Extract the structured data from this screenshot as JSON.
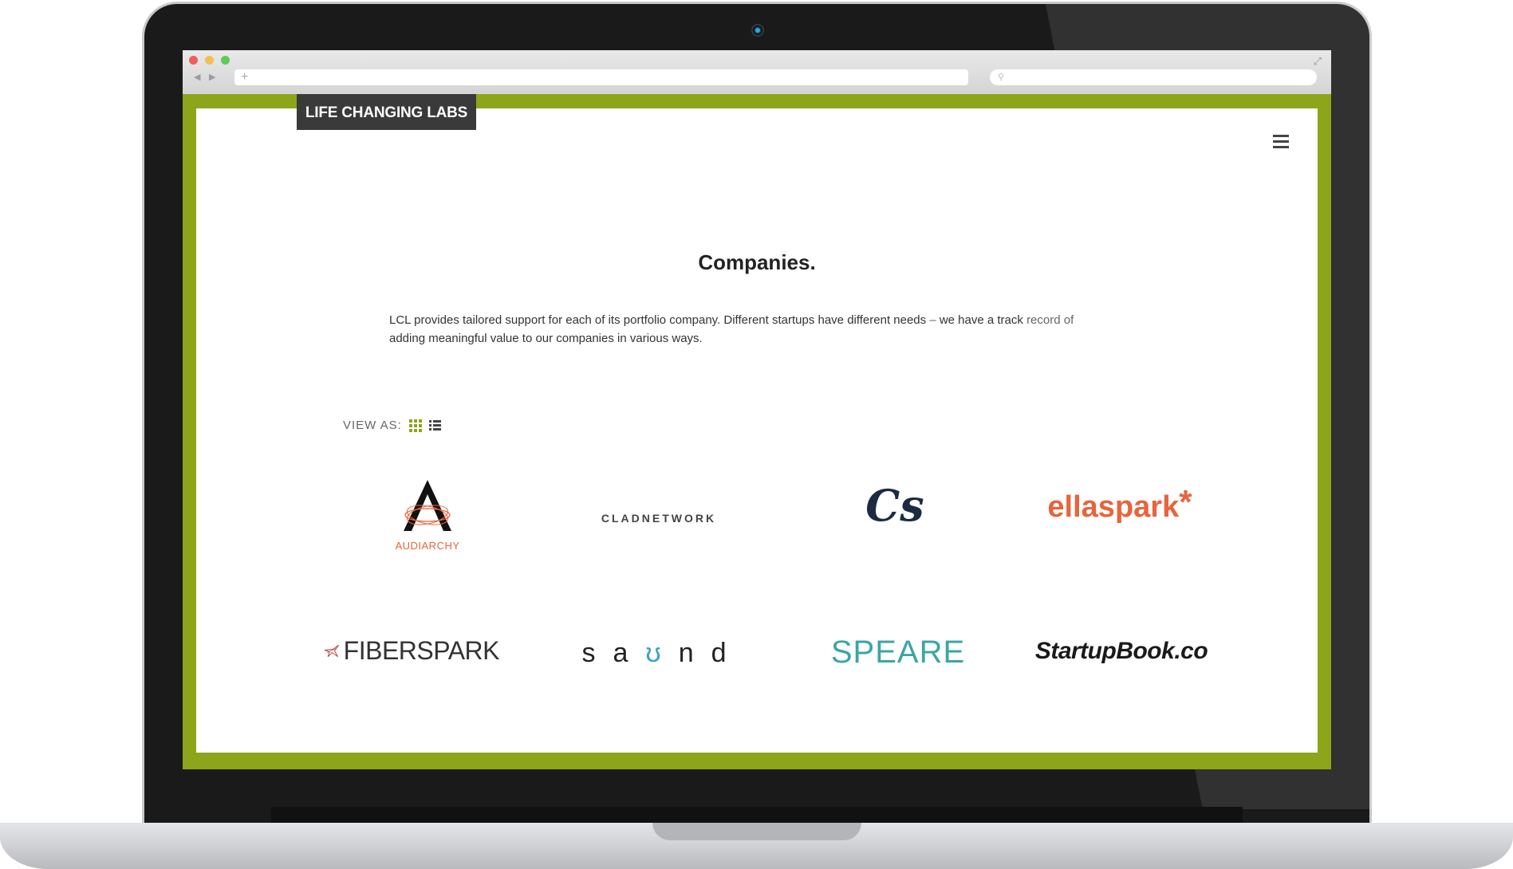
{
  "site": {
    "logo": "LIFE CHANGING LABS",
    "heading": "Companies.",
    "intro_main": "LCL provides tailored support for each of its portfolio company. Different startups have different needs",
    "intro_dash": " – ",
    "intro_rest_a": "we have a track ",
    "intro_rest_b": "record of",
    "intro_line2": "adding meaningful value to our companies in various ways.",
    "view_as_label": "VIEW AS:"
  },
  "companies": [
    {
      "name": "AUDIARCHY",
      "mark": "A"
    },
    {
      "name": "CLADNETWORK"
    },
    {
      "name": "CS",
      "mark": "Cs"
    },
    {
      "name": "ellaspark",
      "suffix": "*"
    },
    {
      "name": "FIBERSPARK"
    },
    {
      "name_parts": [
        "s",
        "a",
        "ʊ",
        "n",
        "d"
      ]
    },
    {
      "name": "SPEARE"
    },
    {
      "name": "StartupBook.co"
    }
  ],
  "colors": {
    "accent_green": "#8ca51a",
    "logo_bg": "#3a3a3a",
    "ellaspark_orange": "#e8643c",
    "speare_teal": "#3aa6a6"
  }
}
